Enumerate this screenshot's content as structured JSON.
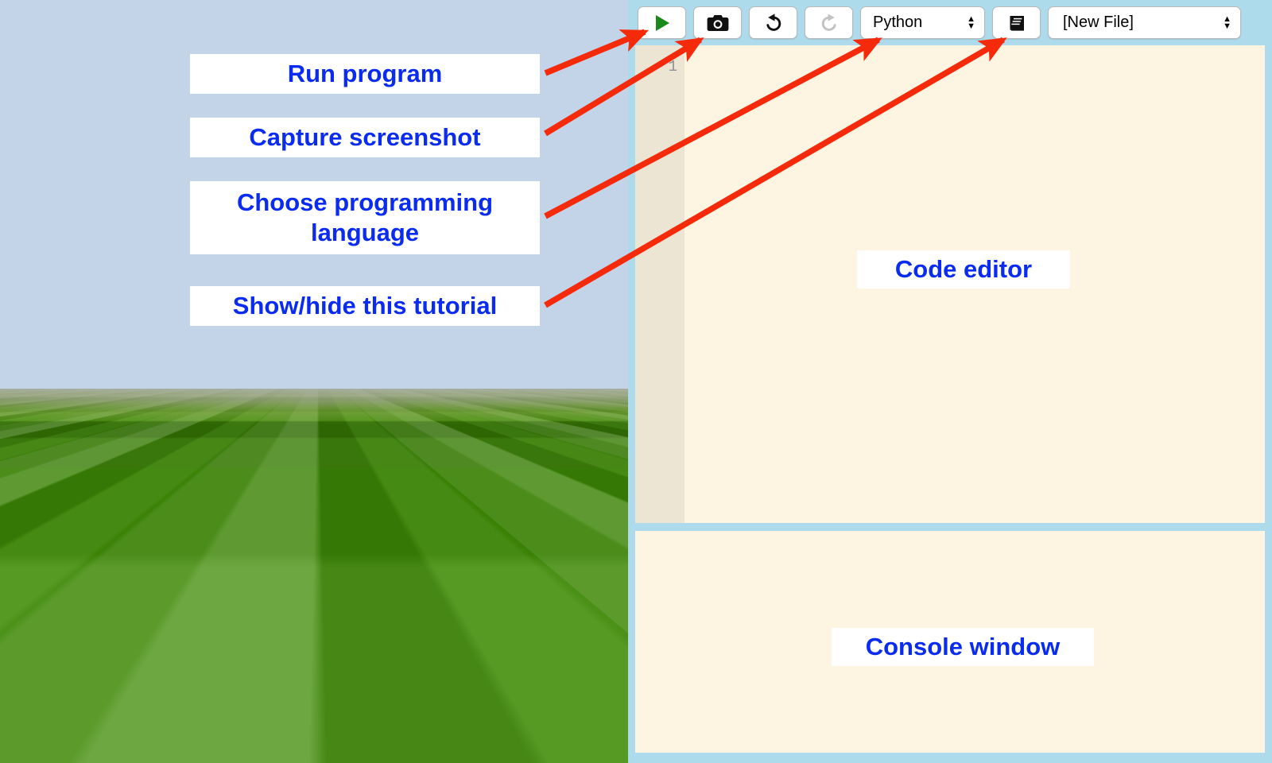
{
  "app": {
    "title": "Code editor IDE with 3D world tutorial overlay"
  },
  "toolbar": {
    "run_button": {
      "label": "",
      "icon": "play-icon",
      "tooltip": "Run program"
    },
    "capture_button": {
      "label": "",
      "icon": "camera-icon",
      "tooltip": "Capture screenshot"
    },
    "undo_button": {
      "label": "",
      "icon": "undo-icon",
      "tooltip": "Undo"
    },
    "redo_button": {
      "label": "",
      "icon": "redo-icon",
      "tooltip": "Redo",
      "disabled": true
    },
    "language_select": {
      "value": "Python",
      "options": [
        "Python"
      ]
    },
    "tutorial_button": {
      "label": "",
      "icon": "book-icon",
      "tooltip": "Show/hide this tutorial"
    },
    "file_select": {
      "value": "[New File]",
      "options": [
        "[New File]"
      ]
    }
  },
  "editor": {
    "line_numbers": [
      "1"
    ],
    "content": "",
    "placeholder": ""
  },
  "console": {
    "content": ""
  },
  "annotations": [
    {
      "id": "run",
      "text": "Run program"
    },
    {
      "id": "capture",
      "text": "Capture screenshot"
    },
    {
      "id": "lang",
      "text": "Choose programming language"
    },
    {
      "id": "tutorial",
      "text": "Show/hide this tutorial"
    },
    {
      "id": "editor",
      "text": "Code editor"
    },
    {
      "id": "console",
      "text": "Console window"
    }
  ],
  "annotation_text": {
    "run": "Run program",
    "capture": "Capture screenshot",
    "lang_line1": "Choose programming",
    "lang_line2": "language",
    "tutorial": "Show/hide this tutorial",
    "editor": "Code editor",
    "console": "Console window"
  },
  "colors": {
    "sky": "#c3d3e8",
    "ground": "#3f8c05",
    "ide_frame": "#aedbeb",
    "editor_bg": "#fdf5e2",
    "gutter_bg": "#ece5d3",
    "annotation_text": "#0a2bf0",
    "annotation_bg": "#ffffff",
    "arrow": "#f42a0a",
    "run_icon": "#1a8a1a",
    "redo_icon_disabled": "#c0c0c0"
  },
  "world": {
    "description": "3D first-person view of a pixelated green grass plane under a pale blue sky"
  }
}
